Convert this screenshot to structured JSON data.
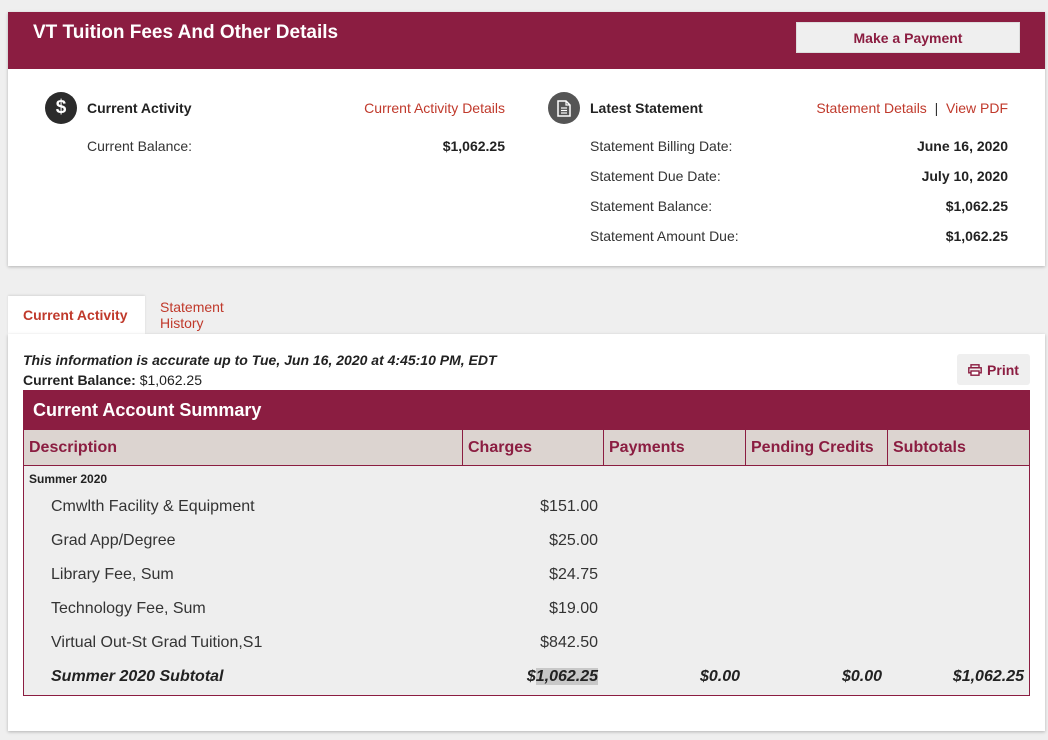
{
  "header": {
    "title": "VT Tuition Fees And Other Details",
    "pay_button": "Make a Payment"
  },
  "current_activity": {
    "title": "Current Activity",
    "link": "Current Activity Details",
    "balance_label": "Current Balance:",
    "balance_value": "$1,062.25"
  },
  "latest_statement": {
    "title": "Latest Statement",
    "details_link": "Statement Details",
    "separator": "|",
    "pdf_link": "View PDF",
    "rows": [
      {
        "label": "Statement Billing Date:",
        "value": "June 16, 2020"
      },
      {
        "label": "Statement Due Date:",
        "value": "July 10, 2020"
      },
      {
        "label": "Statement Balance:",
        "value": "$1,062.25"
      },
      {
        "label": "Statement Amount Due:",
        "value": "$1,062.25"
      }
    ]
  },
  "tabs": [
    {
      "label": "Current Activity",
      "active": true
    },
    {
      "label": "Statement History",
      "active": false
    }
  ],
  "content": {
    "accurate_text": "This information is accurate up to Tue, Jun 16, 2020 at 4:45:10 PM, EDT",
    "balance_label": "Current Balance:",
    "balance_value": "$1,062.25",
    "print_label": "Print"
  },
  "summary": {
    "title": "Current Account Summary",
    "columns": [
      "Description",
      "Charges",
      "Payments",
      "Pending Credits",
      "Subtotals"
    ],
    "term": "Summer 2020",
    "items": [
      {
        "desc": "Cmwlth Facility & Equipment",
        "charge": "$151.00"
      },
      {
        "desc": "Grad App/Degree",
        "charge": "$25.00"
      },
      {
        "desc": "Library Fee, Sum",
        "charge": "$24.75"
      },
      {
        "desc": "Technology Fee, Sum",
        "charge": "$19.00"
      },
      {
        "desc": "Virtual Out-St Grad Tuition,S1",
        "charge": "$842.50"
      }
    ],
    "subtotal": {
      "label": "Summer 2020 Subtotal",
      "charges_prefix": "$",
      "charges_rest": "1,062.25",
      "payments": "$0.00",
      "pending": "$0.00",
      "subtotal": "$1,062.25"
    }
  },
  "colors": {
    "brand": "#8b1d41",
    "link": "#c0392b"
  }
}
